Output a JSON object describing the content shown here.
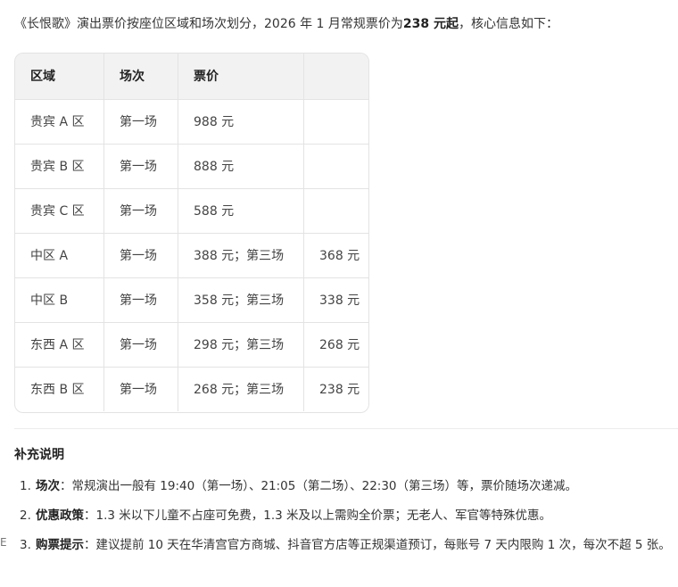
{
  "intro": {
    "prefix": "《长恨歌》演出票价按座位区域和场次划分，2026 年 1 月常规票价为",
    "highlight": "238 元起",
    "suffix": "，核心信息如下："
  },
  "table": {
    "headers": [
      "区域",
      "场次",
      "票价",
      ""
    ],
    "rows": [
      [
        "贵宾 A 区",
        "第一场",
        "988 元",
        ""
      ],
      [
        "贵宾 B 区",
        "第一场",
        "888 元",
        ""
      ],
      [
        "贵宾 C 区",
        "第一场",
        "588 元",
        ""
      ],
      [
        "中区 A",
        "第一场",
        "388 元；第三场",
        "368 元"
      ],
      [
        "中区 B",
        "第一场",
        "358 元；第三场",
        "338 元"
      ],
      [
        "东西 A 区",
        "第一场",
        "298 元；第三场",
        "268 元"
      ],
      [
        "东西 B 区",
        "第一场",
        "268 元；第三场",
        "238 元"
      ]
    ]
  },
  "supplement": {
    "title": "补充说明",
    "items": [
      {
        "num": "1.",
        "label": "场次",
        "text": "：常规演出一般有 19:40（第一场）、21:05（第二场）、22:30（第三场）等，票价随场次递减。"
      },
      {
        "num": "2.",
        "label": "优惠政策",
        "text": "：1.3 米以下儿童不占座可免费，1.3 米及以上需购全价票；无老人、军官等特殊优惠。"
      },
      {
        "num": "3.",
        "label": "购票提示",
        "text": "：建议提前 10 天在华清宫官方商城、抖音官方店等正规渠道预订，每账号 7 天内限购 1 次，每次不超 5 张。"
      }
    ]
  },
  "edge_mark": "E"
}
